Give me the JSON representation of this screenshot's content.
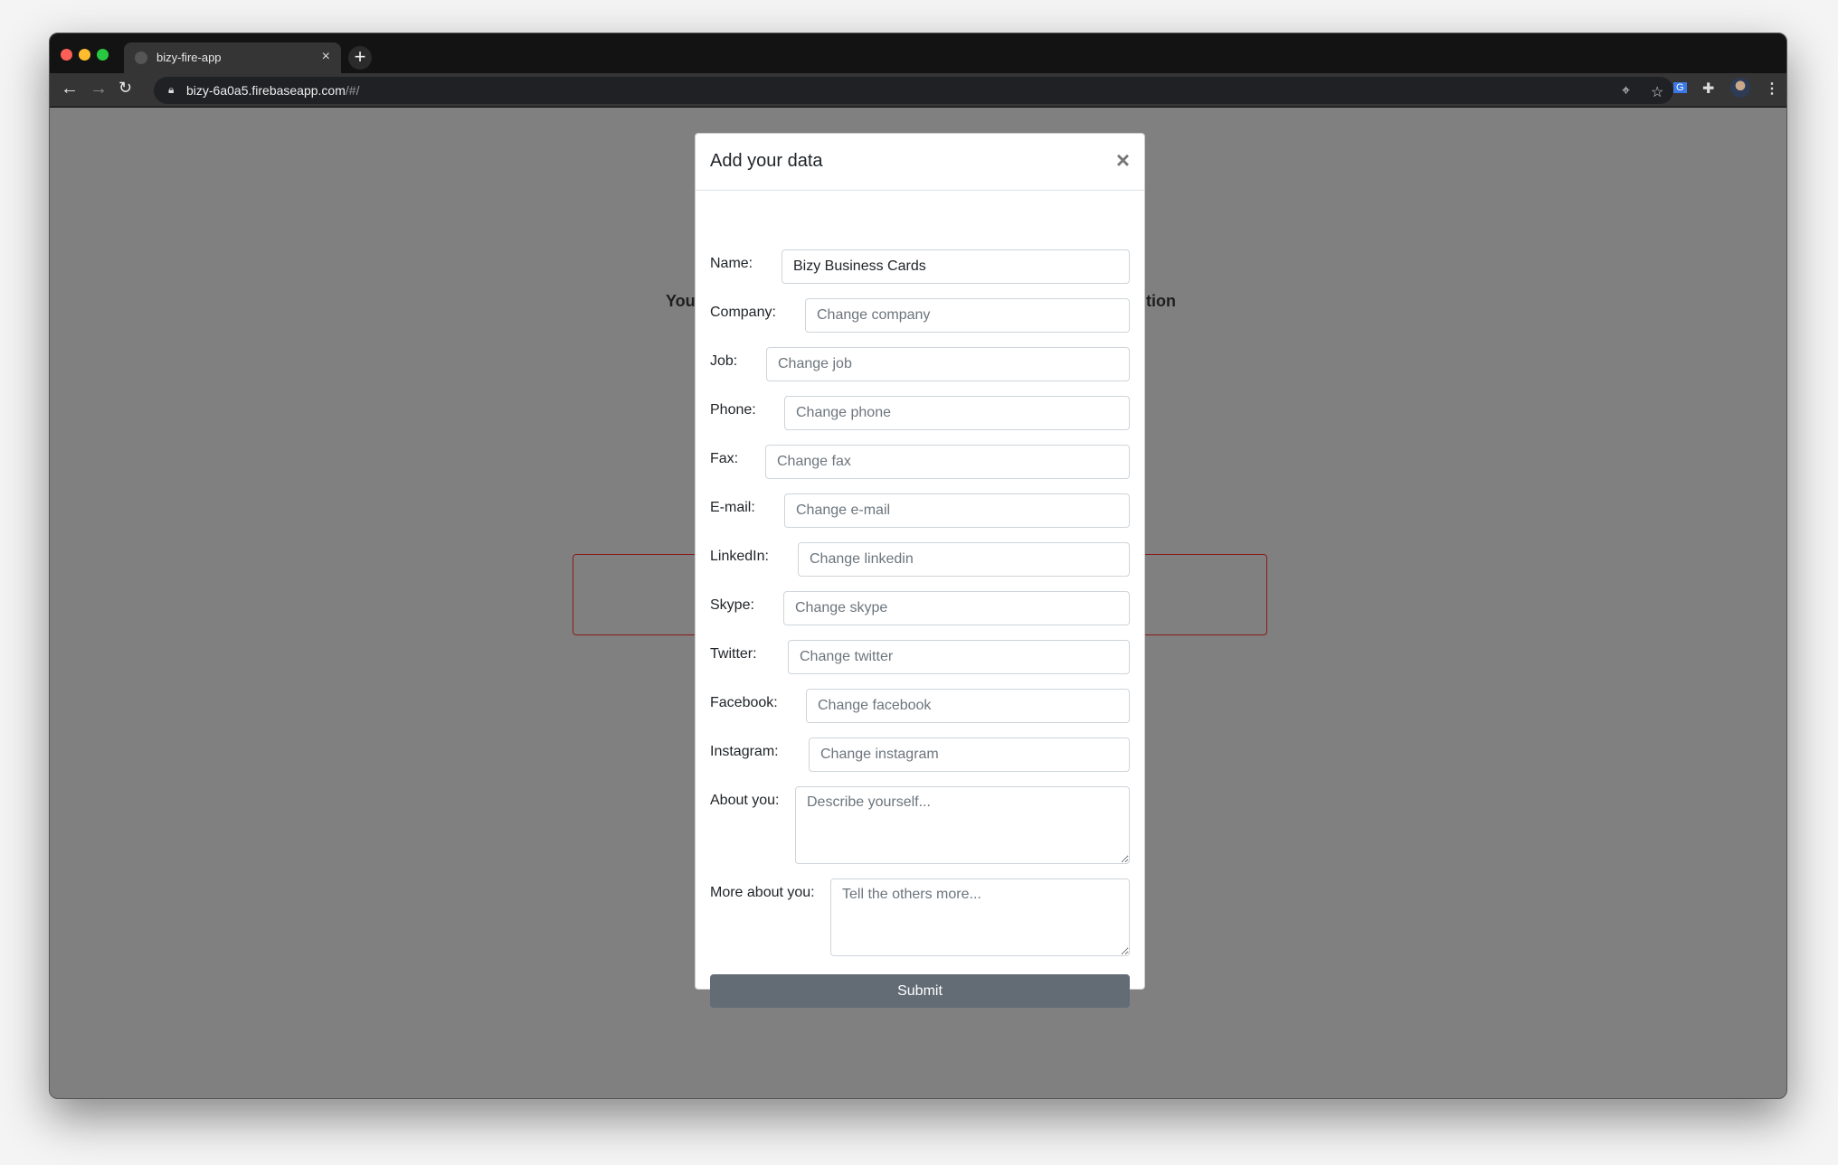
{
  "browser": {
    "tab_title": "bizy-fire-app",
    "url_host": "bizy-6a0a5.firebaseapp.com",
    "url_path": "/#/",
    "traffic_colors": [
      "#fe5f57",
      "#febc2e",
      "#28c840"
    ]
  },
  "background": {
    "text_left": "You",
    "text_right": "tion",
    "box_border": "#8b1a1a"
  },
  "modal": {
    "title": "Add your data",
    "close": "×",
    "fields": [
      {
        "label": "Name:",
        "value": "Bizy Business Cards",
        "placeholder": ""
      },
      {
        "label": "Company:",
        "value": "",
        "placeholder": "Change company"
      },
      {
        "label": "Job:",
        "value": "",
        "placeholder": "Change job"
      },
      {
        "label": "Phone:",
        "value": "",
        "placeholder": "Change phone"
      },
      {
        "label": "Fax:",
        "value": "",
        "placeholder": "Change fax"
      },
      {
        "label": "E-mail:",
        "value": "",
        "placeholder": "Change e-mail"
      },
      {
        "label": "LinkedIn:",
        "value": "",
        "placeholder": "Change linkedin"
      },
      {
        "label": "Skype:",
        "value": "",
        "placeholder": "Change skype"
      },
      {
        "label": "Twitter:",
        "value": "",
        "placeholder": "Change twitter"
      },
      {
        "label": "Facebook:",
        "value": "",
        "placeholder": "Change facebook"
      },
      {
        "label": "Instagram:",
        "value": "",
        "placeholder": "Change instagram"
      }
    ],
    "about": {
      "label": "About you:",
      "placeholder": "Describe yourself..."
    },
    "more": {
      "label": "More about you:",
      "placeholder": "Tell the others more..."
    },
    "submit": "Submit",
    "submit_color": "#636b74"
  }
}
